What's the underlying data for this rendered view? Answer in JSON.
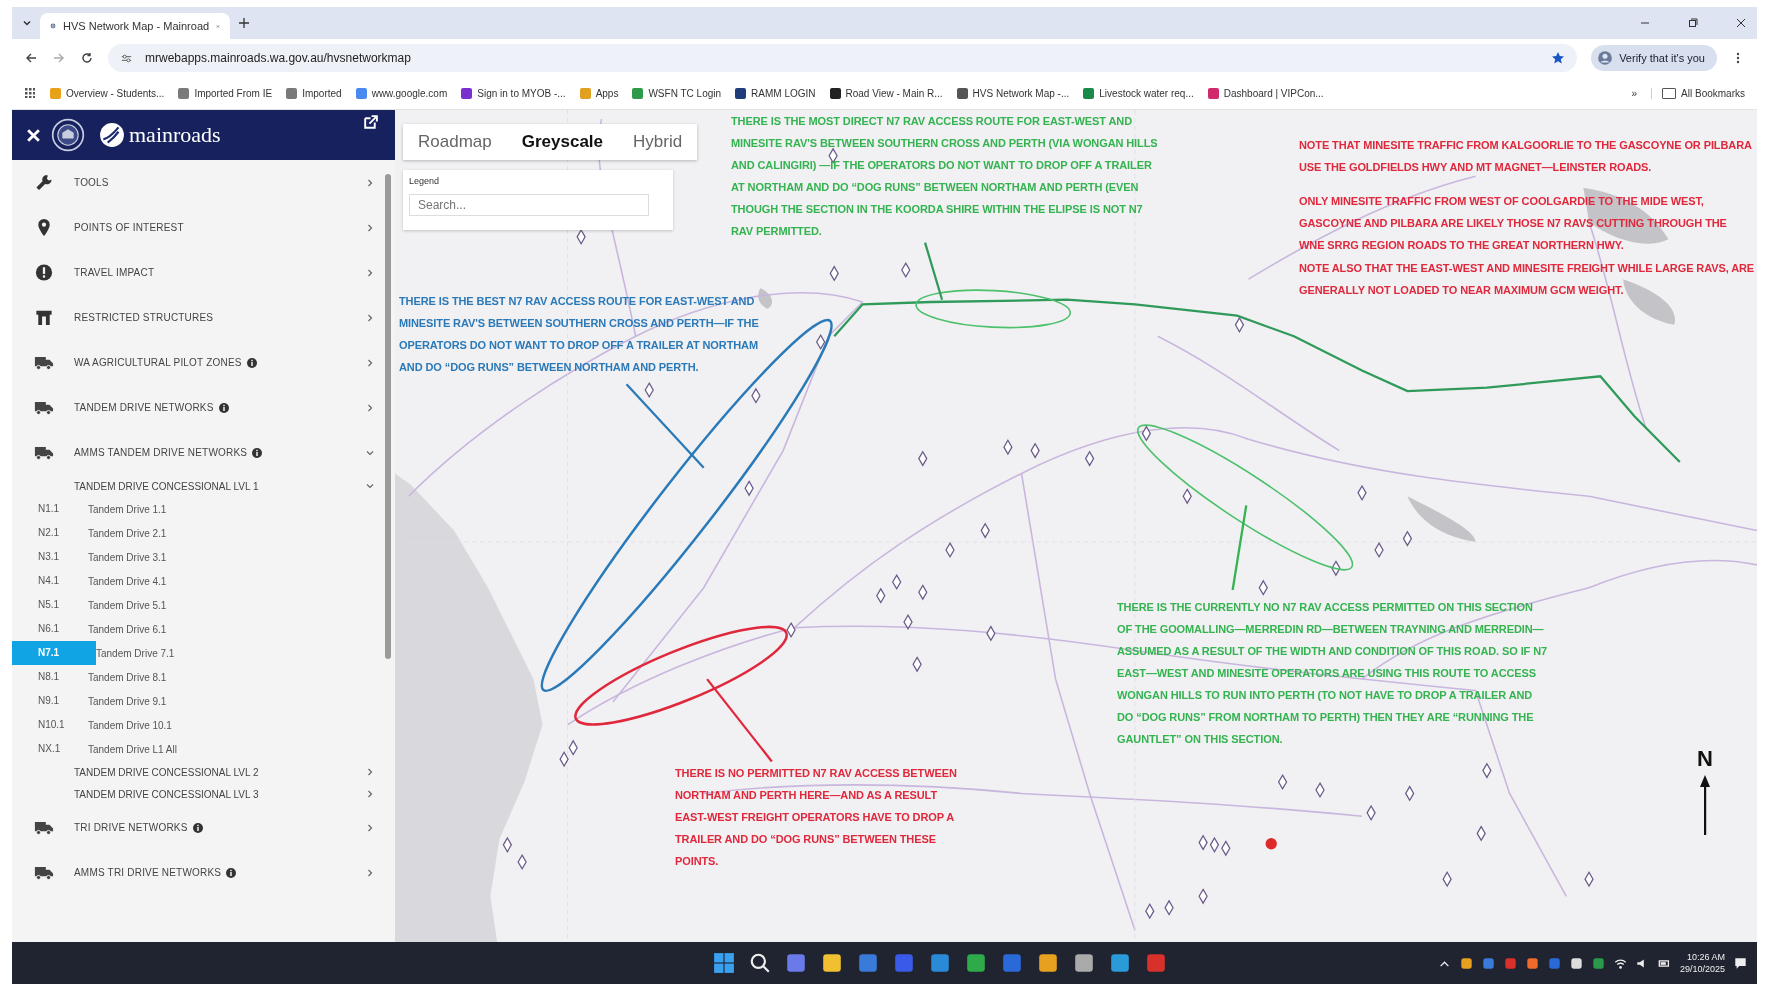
{
  "browser": {
    "tab_title": "HVS Network Map - Mainroad",
    "url": "mrwebapps.mainroads.wa.gov.au/hvsnetworkmap",
    "profile_button": "Verify that it's you",
    "bookmarks": [
      "Overview - Students...",
      "Imported From IE",
      "Imported",
      "www.google.com",
      "Sign in to MYOB -...",
      "Apps",
      "WSFN TC Login",
      "RAMM LOGIN",
      "Road View - Main R...",
      "HVS Network Map -...",
      "Livestock water req...",
      "Dashboard | VIPCon..."
    ],
    "bookmarks_more": "»",
    "all_bookmarks": "All Bookmarks"
  },
  "sidebar": {
    "logo_text": "mainroads",
    "items": [
      {
        "kind": "wrench",
        "label": "TOOLS",
        "info": false,
        "expanded": false
      },
      {
        "kind": "pin",
        "label": "POINTS OF INTEREST",
        "info": false,
        "expanded": false
      },
      {
        "kind": "alert",
        "label": "TRAVEL IMPACT",
        "info": false,
        "expanded": false
      },
      {
        "kind": "structure",
        "label": "RESTRICTED STRUCTURES",
        "info": false,
        "expanded": false
      },
      {
        "kind": "truck",
        "label": "WA AGRICULTURAL PILOT ZONES",
        "info": true,
        "expanded": false
      },
      {
        "kind": "truck",
        "label": "TANDEM DRIVE NETWORKS",
        "info": true,
        "expanded": false
      },
      {
        "kind": "truck",
        "label": "AMMS TANDEM DRIVE NETWORKS",
        "info": true,
        "expanded": true,
        "children": [
          {
            "label": "TANDEM DRIVE CONCESSIONAL LVL 1",
            "expanded": true,
            "children": [
              {
                "code": "N1.1",
                "label": "Tandem Drive 1.1",
                "selected": false
              },
              {
                "code": "N2.1",
                "label": "Tandem Drive 2.1",
                "selected": false
              },
              {
                "code": "N3.1",
                "label": "Tandem Drive 3.1",
                "selected": false
              },
              {
                "code": "N4.1",
                "label": "Tandem Drive 4.1",
                "selected": false
              },
              {
                "code": "N5.1",
                "label": "Tandem Drive 5.1",
                "selected": false
              },
              {
                "code": "N6.1",
                "label": "Tandem Drive 6.1",
                "selected": false
              },
              {
                "code": "N7.1",
                "label": "Tandem Drive 7.1",
                "selected": true
              },
              {
                "code": "N8.1",
                "label": "Tandem Drive 8.1",
                "selected": false
              },
              {
                "code": "N9.1",
                "label": "Tandem Drive 9.1",
                "selected": false
              },
              {
                "code": "N10.1",
                "label": "Tandem Drive 10.1",
                "selected": false
              },
              {
                "code": "NX.1",
                "label": "Tandem Drive L1 All",
                "selected": false
              }
            ]
          },
          {
            "label": "TANDEM DRIVE CONCESSIONAL LVL 2",
            "expanded": false
          },
          {
            "label": "TANDEM DRIVE CONCESSIONAL LVL 3",
            "expanded": false
          }
        ]
      },
      {
        "kind": "truck",
        "label": "TRI DRIVE NETWORKS",
        "info": true,
        "expanded": false
      },
      {
        "kind": "truck",
        "label": "AMMS TRI DRIVE NETWORKS",
        "info": true,
        "expanded": false
      }
    ]
  },
  "map": {
    "map_types": [
      {
        "label": "Roadmap",
        "selected": false
      },
      {
        "label": "Greyscale",
        "selected": true
      },
      {
        "label": "Hybrid",
        "selected": false
      }
    ],
    "legend": {
      "title": "Legend",
      "search_placeholder": "Search..."
    },
    "annotations": [
      {
        "text": "THERE IS THE MOST DIRECT N7 RAV ACCESS ROUTE FOR EAST-WEST AND MINESITE RAV'S BETWEEN SOUTHERN CROSS AND PERTH (VIA WONGAN HILLS AND CALINGIRI) —IF THE OPERATORS DO NOT WANT TO DROP OFF A TRAILER AT NORTHAM AND DO “DOG RUNS” BETWEEN NORTHAM AND PERTH (EVEN THOUGH THE SECTION IN THE KOORDA SHIRE WITHIN THE ELIPSE IS NOT N7 RAV PERMITTED.",
        "color": "#34b350"
      },
      {
        "text": "THERE IS THE BEST N7 RAV ACCESS ROUTE FOR EAST-WEST AND MINESITE RAV'S BETWEEN SOUTHERN CROSS AND PERTH—IF THE OPERATORS DO NOT WANT TO DROP OFF A TRAILER AT NORTHAM AND DO “DOG RUNS” BETWEEN NORTHAM AND PERTH.",
        "color": "#2a79b8"
      },
      {
        "text": "NOTE THAT MINESITE TRAFFIC FROM KALGOORLIE TO THE GASCOYNE OR PILBARA USE THE GOLDFIELDS HWY AND MT MAGNET—LEINSTER ROADS.",
        "color": "#e0283c"
      },
      {
        "text": "ONLY MINESITE TRAFFIC FROM WEST OF COOLGARDIE TO THE MIDE WEST, GASCOYNE AND PILBARA ARE LIKELY THOSE N7 RAVS CUTTING THROUGH THE WNE SRRG REGION ROADS TO THE GREAT NORTHERN HWY.",
        "color": "#e0283c"
      },
      {
        "text": "NOTE ALSO THAT THE EAST-WEST AND MINESITE FREIGHT WHILE LARGE RAVS, ARE GENERALLY NOT LOADED TO NEAR MAXIMUM GCM WEIGHT.",
        "color": "#e0283c"
      },
      {
        "text": "THERE IS THE CURRENTLY NO N7 RAV ACCESS PERMITTED ON THIS SECTION OF THE GOOMALLING—MERREDIN RD—BETWEEN TRAYNING AND MERREDIN—ASSUMED AS A RESULT OF THE WIDTH AND CONDITION OF THIS ROAD. SO IF N7 EAST—WEST AND MINESITE OPERATORS ARE USING THIS ROUTE TO ACCESS WONGAN HILLS TO RUN INTO PERTH (TO NOT HAVE TO DROP A TRAILER AND DO “DOG RUNS” FROM NORTHAM TO PERTH) THEN THEY ARE “RUNNING THE GAUNTLET” ON THIS SECTION.",
        "color": "#34b350"
      },
      {
        "text": "THERE IS NO PERMITTED N7 RAV ACCESS BETWEEN NORTHAM AND PERTH HERE—AND AS A RESULT EAST-WEST FREIGHT OPERATORS HAVE TO DROP A TRAILER AND DO “DOG RUNS” BETWEEN THESE POINTS.",
        "color": "#e0283c"
      }
    ],
    "north_label": "N"
  },
  "taskbar": {
    "time": "10:26 AM",
    "date": "29/10/2025"
  }
}
